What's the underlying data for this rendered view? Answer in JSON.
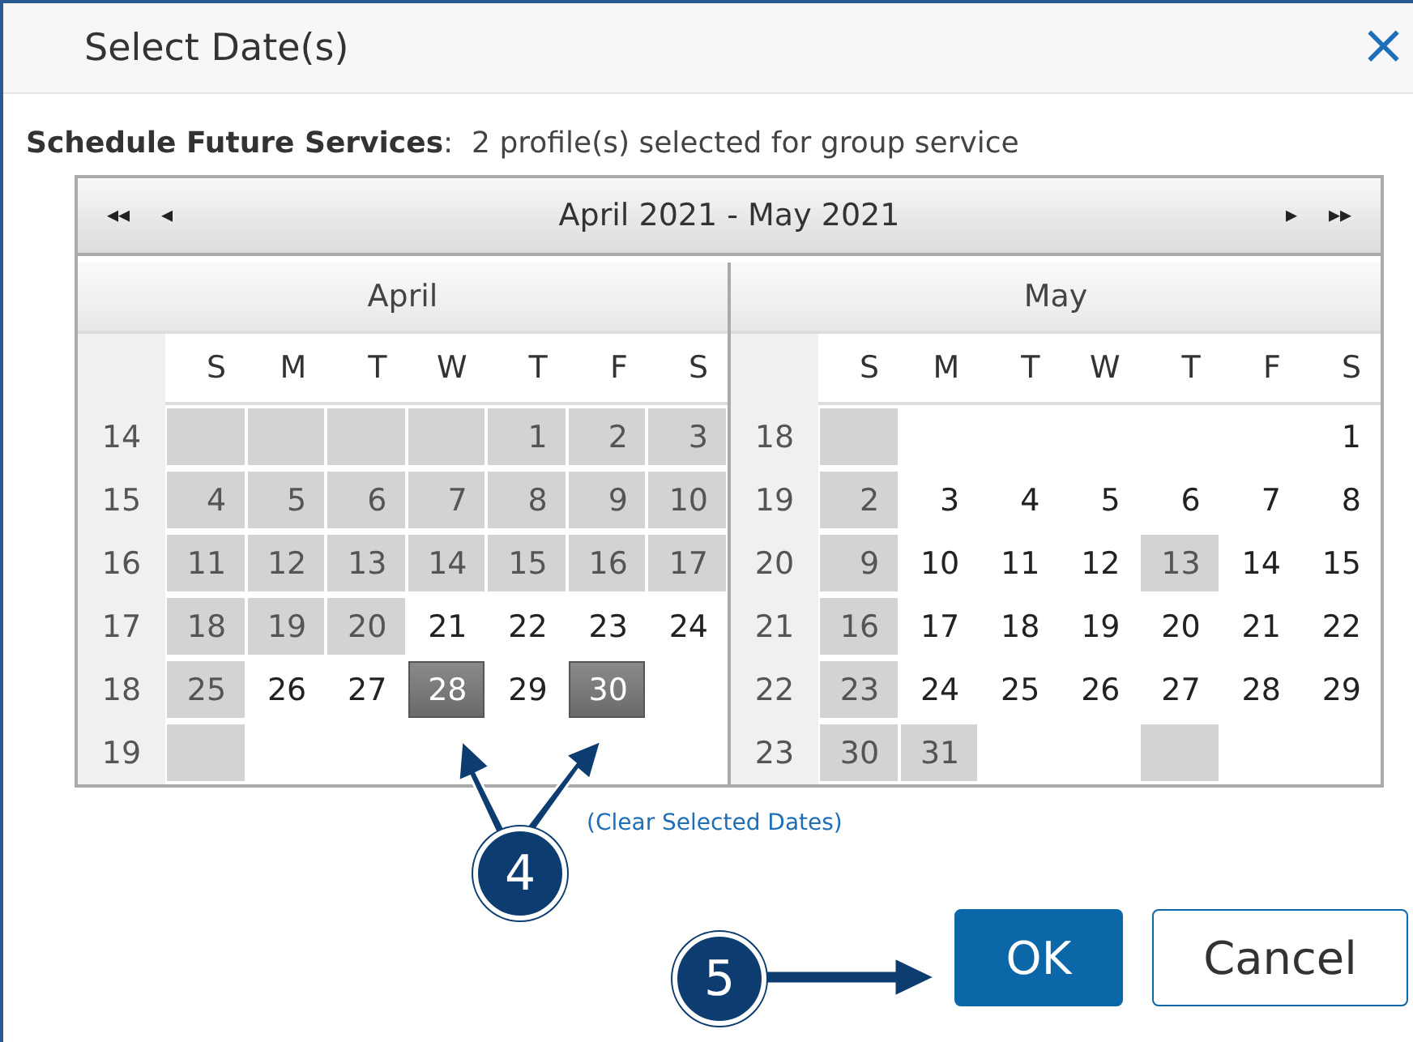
{
  "dialog": {
    "title": "Select Date(s)",
    "close": "×"
  },
  "summary": {
    "text": "**Schedule Future Services**:  2 profile(s) selected for group service"
  },
  "navigator": {
    "first": "◂◂",
    "prev": "◂",
    "range": "April 2021 - May 2021",
    "next": "▸",
    "last": "▸▸"
  },
  "months": [
    {
      "name": "April",
      "weekdays": [
        "S",
        "M",
        "T",
        "W",
        "T",
        "F",
        "S"
      ],
      "weeks": [
        {
          "week": "14",
          "days": [
            {
              "disabled": true,
              "selected": false
            },
            {
              "disabled": true,
              "selected": false
            },
            {
              "disabled": true,
              "selected": false
            },
            {
              "disabled": true,
              "selected": false
            },
            {
              "day": "1",
              "disabled": true,
              "selected": false
            },
            {
              "day": "2",
              "disabled": true,
              "selected": false
            },
            {
              "day": "3",
              "disabled": true,
              "selected": false
            }
          ]
        },
        {
          "week": "15",
          "days": [
            {
              "day": "4",
              "disabled": true,
              "selected": false
            },
            {
              "day": "5",
              "disabled": true,
              "selected": false
            },
            {
              "day": "6",
              "disabled": true,
              "selected": false
            },
            {
              "day": "7",
              "disabled": true,
              "selected": false
            },
            {
              "day": "8",
              "disabled": true,
              "selected": false
            },
            {
              "day": "9",
              "disabled": true,
              "selected": false
            },
            {
              "day": "10",
              "disabled": true,
              "selected": false
            }
          ]
        },
        {
          "week": "16",
          "days": [
            {
              "day": "11",
              "disabled": true,
              "selected": false
            },
            {
              "day": "12",
              "disabled": true,
              "selected": false
            },
            {
              "day": "13",
              "disabled": true,
              "selected": false
            },
            {
              "day": "14",
              "disabled": true,
              "selected": false
            },
            {
              "day": "15",
              "disabled": true,
              "selected": false
            },
            {
              "day": "16",
              "disabled": true,
              "selected": false
            },
            {
              "day": "17",
              "disabled": true,
              "selected": false
            }
          ]
        },
        {
          "week": "17",
          "days": [
            {
              "day": "18",
              "disabled": true,
              "selected": false
            },
            {
              "day": "19",
              "disabled": true,
              "selected": false
            },
            {
              "day": "20",
              "disabled": true,
              "selected": false
            },
            {
              "day": "21",
              "disabled": false,
              "selected": false
            },
            {
              "day": "22",
              "disabled": false,
              "selected": false
            },
            {
              "day": "23",
              "disabled": false,
              "selected": false
            },
            {
              "day": "24",
              "disabled": false,
              "selected": false
            }
          ]
        },
        {
          "week": "18",
          "days": [
            {
              "day": "25",
              "disabled": true,
              "selected": false
            },
            {
              "day": "26",
              "disabled": false,
              "selected": false
            },
            {
              "day": "27",
              "disabled": false,
              "selected": false
            },
            {
              "day": "28",
              "disabled": false,
              "selected": true
            },
            {
              "day": "29",
              "disabled": false,
              "selected": false
            },
            {
              "day": "30",
              "disabled": false,
              "selected": true
            },
            {
              "disabled": false,
              "selected": false
            }
          ]
        },
        {
          "week": "19",
          "days": [
            {
              "disabled": true,
              "selected": false
            },
            {
              "disabled": false,
              "selected": false
            },
            {
              "disabled": false,
              "selected": false
            },
            {
              "disabled": false,
              "selected": false
            },
            {
              "disabled": false,
              "selected": false
            },
            {
              "disabled": false,
              "selected": false
            },
            {
              "disabled": false,
              "selected": false
            }
          ]
        }
      ]
    },
    {
      "name": "May",
      "weekdays": [
        "S",
        "M",
        "T",
        "W",
        "T",
        "F",
        "S"
      ],
      "weeks": [
        {
          "week": "18",
          "days": [
            {
              "disabled": true,
              "selected": false
            },
            {
              "disabled": false,
              "selected": false
            },
            {
              "disabled": false,
              "selected": false
            },
            {
              "disabled": false,
              "selected": false
            },
            {
              "disabled": false,
              "selected": false
            },
            {
              "disabled": false,
              "selected": false
            },
            {
              "day": "1",
              "disabled": false,
              "selected": false
            }
          ]
        },
        {
          "week": "19",
          "days": [
            {
              "day": "2",
              "disabled": true,
              "selected": false
            },
            {
              "day": "3",
              "disabled": false,
              "selected": false
            },
            {
              "day": "4",
              "disabled": false,
              "selected": false
            },
            {
              "day": "5",
              "disabled": false,
              "selected": false
            },
            {
              "day": "6",
              "disabled": false,
              "selected": false
            },
            {
              "day": "7",
              "disabled": false,
              "selected": false
            },
            {
              "day": "8",
              "disabled": false,
              "selected": false
            }
          ]
        },
        {
          "week": "20",
          "days": [
            {
              "day": "9",
              "disabled": true,
              "selected": false
            },
            {
              "day": "10",
              "disabled": false,
              "selected": false
            },
            {
              "day": "11",
              "disabled": false,
              "selected": false
            },
            {
              "day": "12",
              "disabled": false,
              "selected": false
            },
            {
              "day": "13",
              "disabled": true,
              "selected": false
            },
            {
              "day": "14",
              "disabled": false,
              "selected": false
            },
            {
              "day": "15",
              "disabled": false,
              "selected": false
            }
          ]
        },
        {
          "week": "21",
          "days": [
            {
              "day": "16",
              "disabled": true,
              "selected": false
            },
            {
              "day": "17",
              "disabled": false,
              "selected": false
            },
            {
              "day": "18",
              "disabled": false,
              "selected": false
            },
            {
              "day": "19",
              "disabled": false,
              "selected": false
            },
            {
              "day": "20",
              "disabled": false,
              "selected": false
            },
            {
              "day": "21",
              "disabled": false,
              "selected": false
            },
            {
              "day": "22",
              "disabled": false,
              "selected": false
            }
          ]
        },
        {
          "week": "22",
          "days": [
            {
              "day": "23",
              "disabled": true,
              "selected": false
            },
            {
              "day": "24",
              "disabled": false,
              "selected": false
            },
            {
              "day": "25",
              "disabled": false,
              "selected": false
            },
            {
              "day": "26",
              "disabled": false,
              "selected": false
            },
            {
              "day": "27",
              "disabled": false,
              "selected": false
            },
            {
              "day": "28",
              "disabled": false,
              "selected": false
            },
            {
              "day": "29",
              "disabled": false,
              "selected": false
            }
          ]
        },
        {
          "week": "23",
          "days": [
            {
              "day": "30",
              "disabled": true,
              "selected": false
            },
            {
              "day": "31",
              "disabled": true,
              "selected": false
            },
            {
              "disabled": false,
              "selected": false
            },
            {
              "disabled": false,
              "selected": false
            },
            {
              "disabled": true,
              "selected": false
            },
            {
              "disabled": false,
              "selected": false
            },
            {
              "disabled": false,
              "selected": false
            }
          ]
        }
      ]
    }
  ],
  "clear_link": "(Clear Selected Dates)",
  "buttons": [
    {
      "label": "OK",
      "kind": "primary"
    },
    {
      "label": "Cancel",
      "kind": "secondary"
    }
  ],
  "callouts": [
    {
      "number": "4"
    },
    {
      "number": "5"
    }
  ]
}
